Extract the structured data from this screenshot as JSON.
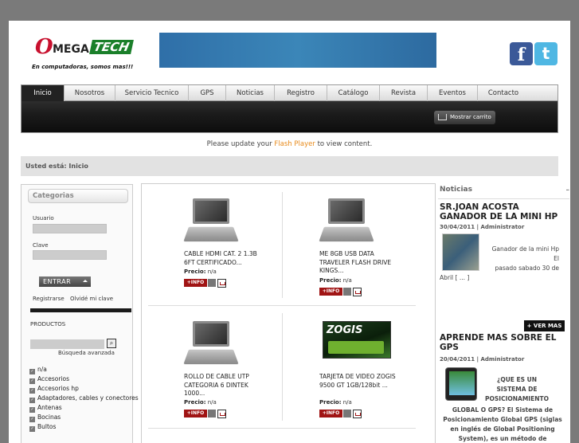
{
  "header": {
    "logo": {
      "omega": "O",
      "mega": "MEGA",
      "tech": "TECH",
      "slogan": "En computadoras, somos mas!!!"
    },
    "social": {
      "facebook": "f",
      "twitter": "t"
    }
  },
  "nav": {
    "tabs": [
      "Inicio",
      "Nosotros",
      "Servicio Tecnico",
      "GPS",
      "Noticias",
      "Registro",
      "Catálogo",
      "Revista",
      "Eventos",
      "Contacto"
    ],
    "active_tab": "Inicio",
    "cart_label": "Mostrar carrito"
  },
  "flash": {
    "before": "Please update your",
    "link": "Flash Player",
    "after": "to view content."
  },
  "breadcrumb": "Usted está: Inicio",
  "sidebar": {
    "categories_title": "Categorias",
    "usuario_label": "Usuario",
    "clave_label": "Clave",
    "enter_button": "ENTRAR",
    "register_link": "Registrarse",
    "forgot_link": "Olvidé mi clave",
    "products_label": "PRODUCTOS",
    "advanced_search": "Búsqueda avanzada",
    "categories": [
      "n/a",
      "Accesorios",
      "Accesorios hp",
      "Adaptadores, cables y conectores",
      "Antenas",
      "Bocinas",
      "Bultos"
    ]
  },
  "products": [
    {
      "name": "CABLE HDMI CAT. 2 1.3B 6FT CERTIFICADO...",
      "price_label": "Precio:",
      "price": "n/a",
      "info": "+INFO",
      "image": "laptop-icon"
    },
    {
      "name": "ME 8GB USB DATA TRAVELER FLASH DRIVE KINGS...",
      "price_label": "Precio:",
      "price": "n/a",
      "info": "+INFO",
      "image": "laptop-icon"
    },
    {
      "name": "ROLLO DE CABLE UTP CATEGORIA 6 DINTEK 1000...",
      "price_label": "Precio:",
      "price": "n/a",
      "info": "+INFO",
      "image": "laptop-icon"
    },
    {
      "name": "TARJETA DE VIDEO ZOGIS 9500 GT 1GB/128bit ...",
      "price_label": "Precio:",
      "price": "n/a",
      "info": "+INFO",
      "image": "zogis-box",
      "brand": "ZOGIS"
    }
  ],
  "news": {
    "title": "Noticias",
    "dash": "–",
    "items": [
      {
        "title": "SR.JOAN ACOSTA GANADOR DE LA MINI HP",
        "meta": "30/04/2011 | Administrator",
        "text_right": "Ganador de la mini Hp",
        "text_el": "El",
        "text_cont": "pasado sabado 30 de",
        "text_tail": "Abril [ ... ]"
      },
      {
        "title": "APRENDE MAS SOBRE EL GPS",
        "meta": "20/04/2011 | Administrator",
        "text_right": "¿QUE ES UN SISTEMA DE POSICIONAMIENTO",
        "text_tail": "GLOBAL O GPS? El Sistema de Posicionamiento Global GPS (siglas en inglés de Global Positioning System), es un método de posicionamient [ ... ]"
      }
    ],
    "more_button": "+ VER MAS"
  }
}
